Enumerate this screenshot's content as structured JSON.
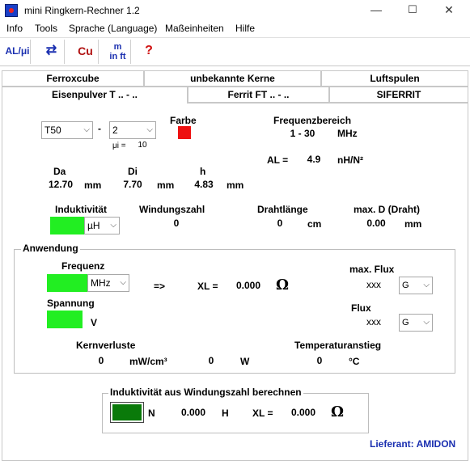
{
  "window": {
    "title": "mini Ringkern-Rechner 1.2"
  },
  "menu": [
    "Info",
    "Tools",
    "Sprache (Language)",
    "Maßeinheiten",
    "Hilfe"
  ],
  "toolbar": {
    "btn1": "AL/μi",
    "btn2": "⇄",
    "btn3": "Cu",
    "btn4_top": "m",
    "btn4_bottom": "in ft",
    "btn5": "?"
  },
  "tabs_top": [
    "Ferroxcube",
    "unbekannte Kerne",
    "Luftspulen"
  ],
  "tabs_bottom": [
    "Eisenpulver T .. - ..",
    "Ferrit FT .. - ..",
    "SIFERRIT"
  ],
  "core": {
    "series": "T50",
    "sep": "-",
    "mix": "2",
    "mu_label": "μi =",
    "mu_value": "10",
    "farbe_label": "Farbe",
    "farbe_color": "#ee1111",
    "freq_label": "Frequenzbereich",
    "freq_value": "1 - 30",
    "freq_unit": "MHz",
    "al_label": "AL =",
    "al_value": "4.9",
    "al_unit": "nH/N²"
  },
  "dims": {
    "da_label": "Da",
    "da_value": "12.70",
    "da_unit": "mm",
    "di_label": "Di",
    "di_value": "7.70",
    "di_unit": "mm",
    "h_label": "h",
    "h_value": "4.83",
    "h_unit": "mm"
  },
  "coil": {
    "ind_label": "Induktivität",
    "ind_unit": "µH",
    "wind_label": "Windungszahl",
    "wind_value": "0",
    "draht_label": "Drahtlänge",
    "draht_value": "0",
    "draht_unit": "cm",
    "maxd_label": "max. D (Draht)",
    "maxd_value": "0.00",
    "maxd_unit": "mm"
  },
  "anwendung": {
    "title": "Anwendung",
    "freq_label": "Frequenz",
    "freq_unit": "MHz",
    "arrow": "=>",
    "xl_label": "XL =",
    "xl_value": "0.000",
    "ohm": "Ω",
    "maxflux_label": "max. Flux",
    "maxflux_value": "xxx",
    "maxflux_unit": "G",
    "spannung_label": "Spannung",
    "spannung_unit": "V",
    "flux_label": "Flux",
    "flux_value": "xxx",
    "flux_unit": "G",
    "kern_label": "Kernverluste",
    "kern_value1": "0",
    "kern_unit1": "mW/cm³",
    "kern_value2": "0",
    "kern_unit2": "W",
    "temp_label": "Temperaturanstieg",
    "temp_value": "0",
    "temp_unit": "°C"
  },
  "calc": {
    "title": "Induktivität aus Windungszahl berechnen",
    "n_label": "N",
    "h_value": "0.000",
    "h_unit": "H",
    "xl_label": "XL =",
    "xl_value": "0.000",
    "ohm": "Ω"
  },
  "footer": {
    "supplier": "Lieferant: AMIDON"
  },
  "colors": {
    "green": "#22ee22",
    "dark_green": "#0a7a0a",
    "accent_blue": "#1a2fb0"
  }
}
